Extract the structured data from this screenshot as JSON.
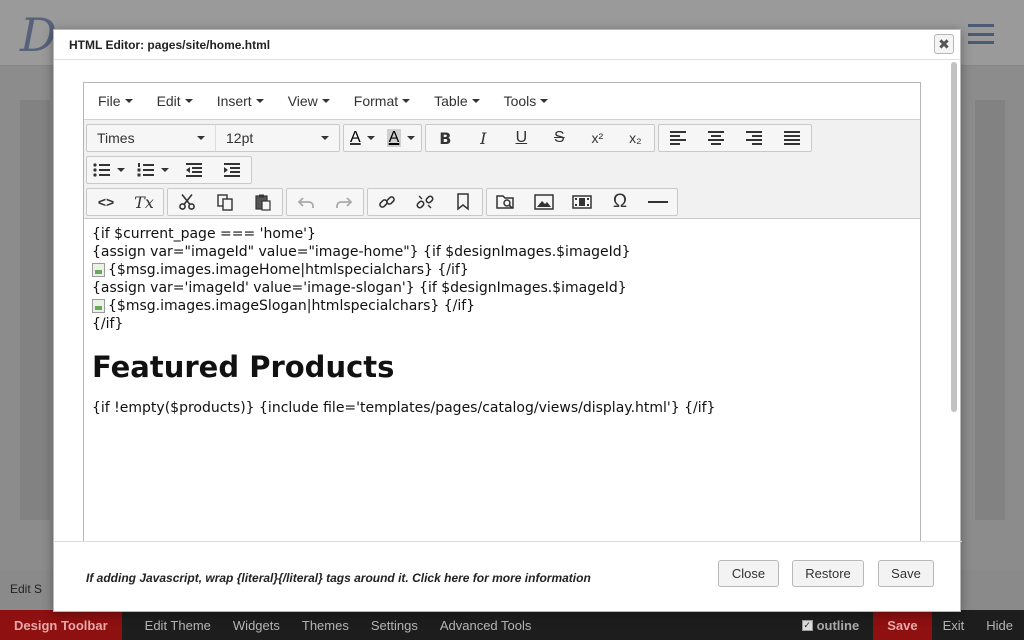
{
  "background": {
    "logo": "D",
    "edit_strip": "Edit S"
  },
  "design_toolbar": {
    "brand": "Design Toolbar",
    "items": [
      "Edit Theme",
      "Widgets",
      "Themes",
      "Settings",
      "Advanced Tools"
    ],
    "outline_label": "outline",
    "outline_checked": true,
    "save": "Save",
    "exit": "Exit",
    "hide": "Hide"
  },
  "modal": {
    "title": "HTML Editor: pages/site/home.html",
    "close_glyph": "✖"
  },
  "menubar": {
    "items": [
      "File",
      "Edit",
      "Insert",
      "View",
      "Format",
      "Table",
      "Tools"
    ]
  },
  "toolbar": {
    "font_family": "Times",
    "font_size": "12pt",
    "icons": {
      "text_color": "A",
      "bg_color": "A",
      "bold": "B",
      "italic": "I",
      "underline": "U",
      "strikethrough": "S",
      "superscript": "x²",
      "subscript": "x₂",
      "source_code": "<>",
      "clear_format": "Tx",
      "special_char": "Ω"
    }
  },
  "content": {
    "line1": "{if $current_page === 'home'}",
    "line2": "{assign var=\"imageId\" value=\"image-home\"} {if $designImages.$imageId}",
    "line3": "{$msg.images.imageHome|htmlspecialchars} {/if}",
    "line4": "{assign var='imageId' value='image-slogan'} {if $designImages.$imageId}",
    "line5": "{$msg.images.imageSlogan|htmlspecialchars} {/if}",
    "line6": "{/if}",
    "heading": "Featured Products",
    "line7": "{if !empty($products)} {include file='templates/pages/catalog/views/display.html'} {/if}"
  },
  "footer": {
    "note": "If adding Javascript, wrap {literal}{/literal} tags around it. Click here for more information",
    "close": "Close",
    "restore": "Restore",
    "save": "Save"
  }
}
